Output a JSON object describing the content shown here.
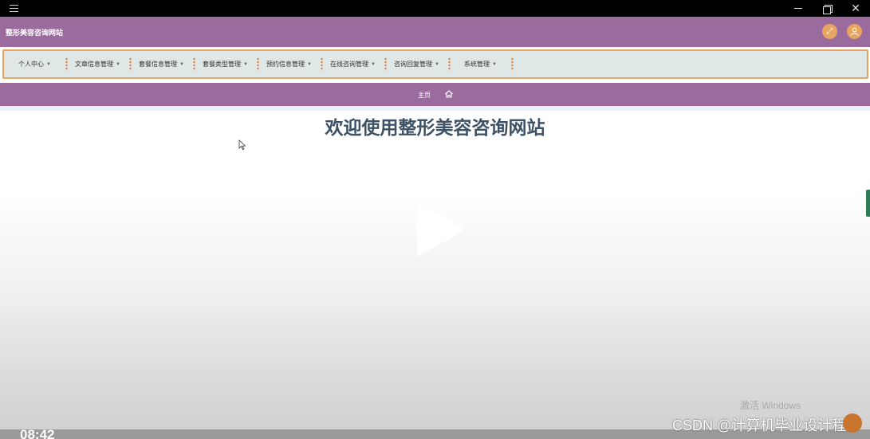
{
  "window": {
    "menu_icon": "hamburger-icon",
    "minimize_icon": "minimize-icon",
    "restore_icon": "restore-icon",
    "close_label": "✕"
  },
  "header": {
    "title": "整形美容咨询网站",
    "fullscreen_glyph": "⤢",
    "user_glyph": "👤",
    "background": "#9b6b9e",
    "accent": "#e8a461"
  },
  "nav": {
    "items": [
      {
        "label": "个人中心"
      },
      {
        "label": "文章信息管理"
      },
      {
        "label": "套餐信息管理"
      },
      {
        "label": "套餐类型管理"
      },
      {
        "label": "预约信息管理"
      },
      {
        "label": "在线咨询管理"
      },
      {
        "label": "咨询回复管理"
      },
      {
        "label": "系统管理"
      }
    ],
    "caret": "▼",
    "separator_color": "#e08a4a"
  },
  "breadcrumb": {
    "home_label": "主页",
    "icon": "home-icon"
  },
  "main": {
    "welcome": "欢迎使用整形美容咨询网站",
    "welcome_color": "#3e5266"
  },
  "overlay": {
    "windows_watermark": "激活 Windows",
    "csdn_watermark": "CSDN @计算机毕业设计程",
    "timestamp": "08:42"
  }
}
